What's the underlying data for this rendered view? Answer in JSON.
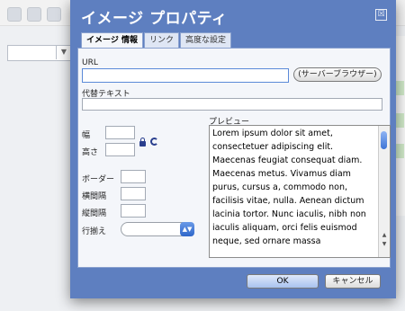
{
  "dialog": {
    "title": "イメージ プロパティ",
    "close_glyph": "☒",
    "tabs": [
      {
        "label": "イメージ 情報",
        "active": true
      },
      {
        "label": "リンク",
        "active": false
      },
      {
        "label": "高度な設定",
        "active": false
      }
    ]
  },
  "form": {
    "url_label": "URL",
    "url_value": "",
    "browse_label": "(サーバーブラウザー)",
    "alt_label": "代替テキスト",
    "alt_value": "",
    "width_label": "幅",
    "height_label": "高さ",
    "border_label": "ボーダー",
    "hspace_label": "横間隔",
    "vspace_label": "縦間隔",
    "align_label": "行揃え",
    "align_value": ""
  },
  "preview": {
    "label": "プレビュー",
    "text": "Lorem ipsum dolor sit amet, consectetuer adipiscing elit. Maecenas feugiat consequat diam. Maecenas metus. Vivamus diam purus, cursus a, commodo non, facilisis vitae, nulla. Aenean dictum lacinia tortor. Nunc iaculis, nibh non iaculis aliquam, orci felis euismod neque, sed ornare massa"
  },
  "buttons": {
    "ok": "OK",
    "cancel": "キャンセル"
  },
  "colors": {
    "dialog_accent": "#5e7fc0",
    "panel_bg": "#f4f6fa"
  }
}
